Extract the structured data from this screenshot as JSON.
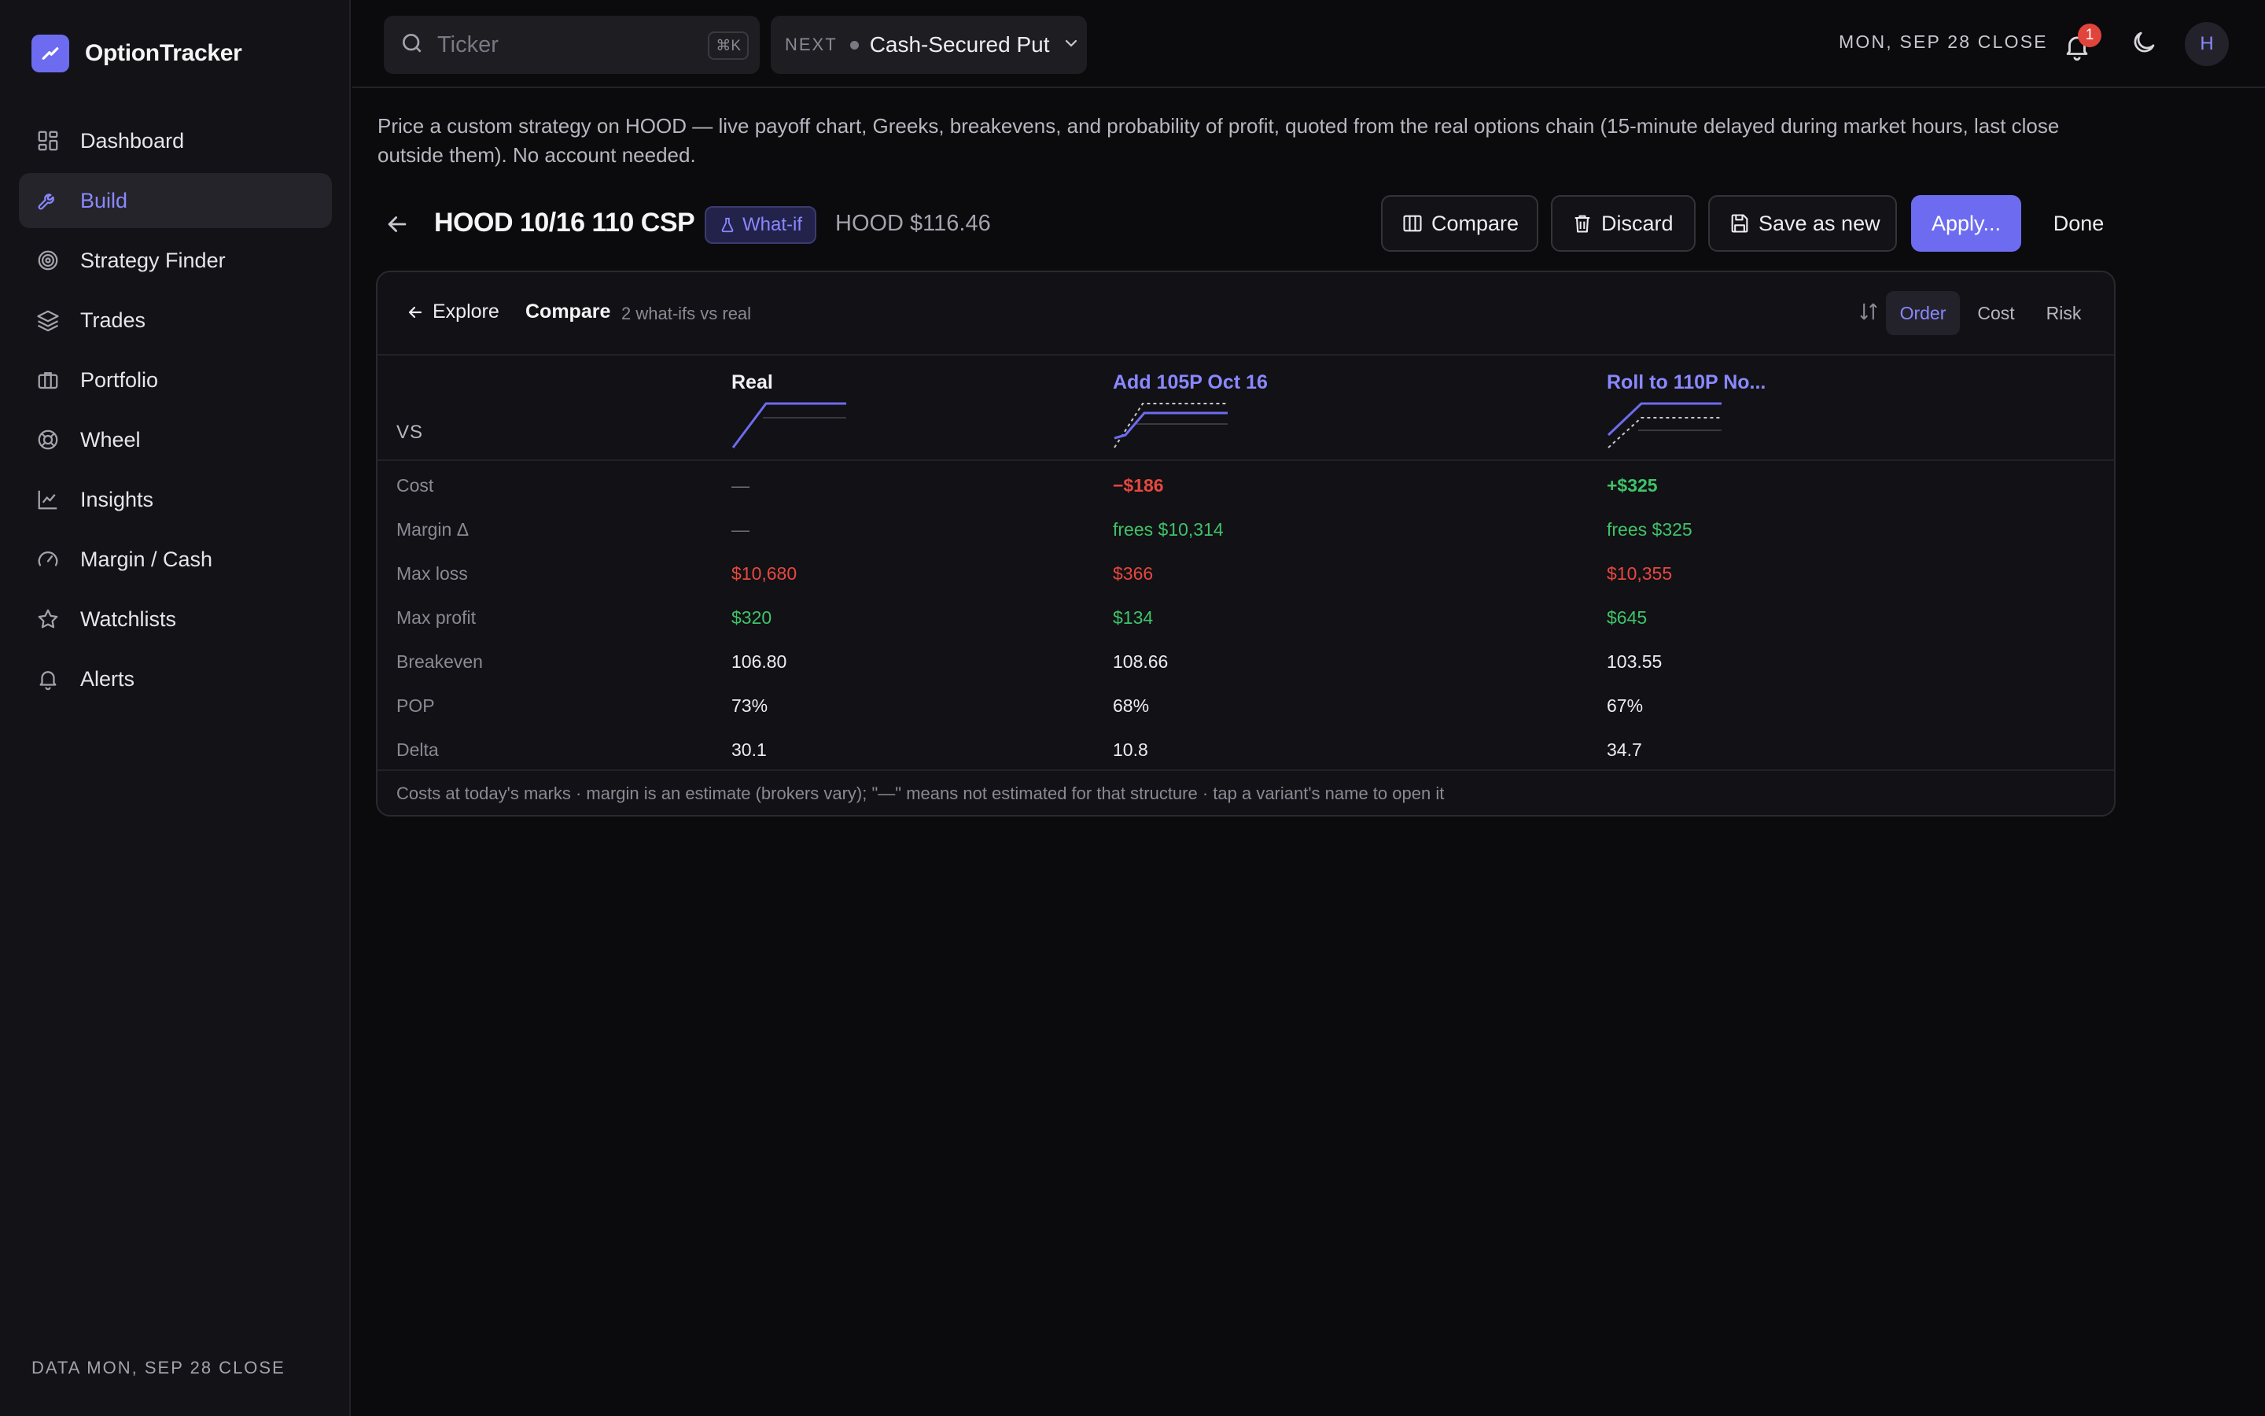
{
  "app": {
    "name": "OptionTracker"
  },
  "sidebar": {
    "items": [
      {
        "label": "Dashboard",
        "icon": "dashboard-icon"
      },
      {
        "label": "Build",
        "icon": "wrench-icon",
        "active": true
      },
      {
        "label": "Strategy Finder",
        "icon": "target-icon"
      },
      {
        "label": "Trades",
        "icon": "layers-icon"
      },
      {
        "label": "Portfolio",
        "icon": "briefcase-icon"
      },
      {
        "label": "Wheel",
        "icon": "lifebuoy-icon"
      },
      {
        "label": "Insights",
        "icon": "chart-line-icon"
      },
      {
        "label": "Margin / Cash",
        "icon": "gauge-icon"
      },
      {
        "label": "Watchlists",
        "icon": "star-icon"
      },
      {
        "label": "Alerts",
        "icon": "bell-icon"
      }
    ],
    "footer": "DATA MON, SEP 28 CLOSE"
  },
  "topbar": {
    "search_placeholder": "Ticker",
    "shortcut": "⌘K",
    "next_label": "NEXT",
    "next_value": "Cash-Secured Put",
    "close_label": "MON, SEP 28 CLOSE",
    "notifications": "1",
    "avatar_initial": "H"
  },
  "intro": "Price a custom strategy on HOOD — live payoff chart, Greeks, breakevens, and probability of profit, quoted from the real options chain (15-minute delayed during market hours, last close outside them). No account needed.",
  "header": {
    "title": "HOOD 10/16 110 CSP",
    "badge": "What-if",
    "quote": "HOOD $116.46",
    "buttons": {
      "compare": "Compare",
      "discard": "Discard",
      "save_as_new": "Save as new",
      "apply": "Apply...",
      "done": "Done"
    }
  },
  "panel": {
    "explore": "Explore",
    "title": "Compare",
    "subtitle": "2 what-ifs vs real",
    "sort_options": [
      "Order",
      "Cost",
      "Risk"
    ],
    "sort_selected": "Order",
    "vs_label": "VS",
    "columns": [
      "Real",
      "Add 105P Oct 16",
      "Roll to 110P No..."
    ],
    "rows": [
      {
        "label": "Cost",
        "values": [
          "—",
          "−$186",
          "+$325"
        ]
      },
      {
        "label": "Margin Δ",
        "values": [
          "—",
          "frees $10,314",
          "frees $325"
        ]
      },
      {
        "label": "Max loss",
        "values": [
          "$10,680",
          "$366",
          "$10,355"
        ]
      },
      {
        "label": "Max profit",
        "values": [
          "$320",
          "$134",
          "$645"
        ]
      },
      {
        "label": "Breakeven",
        "values": [
          "106.80",
          "108.66",
          "103.55"
        ]
      },
      {
        "label": "POP",
        "values": [
          "73%",
          "68%",
          "67%"
        ]
      },
      {
        "label": "Delta",
        "values": [
          "30.1",
          "10.8",
          "34.7"
        ]
      }
    ],
    "footnote": "Costs at today's marks · margin is an estimate (brokers vary); \"—\" means not estimated for that structure · tap a variant's name to open it"
  },
  "colors": {
    "accent": "#6d6cf0",
    "negative": "#e5483f",
    "positive": "#3ec36a",
    "background": "#0b0a0d",
    "sidebar": "#131216"
  }
}
